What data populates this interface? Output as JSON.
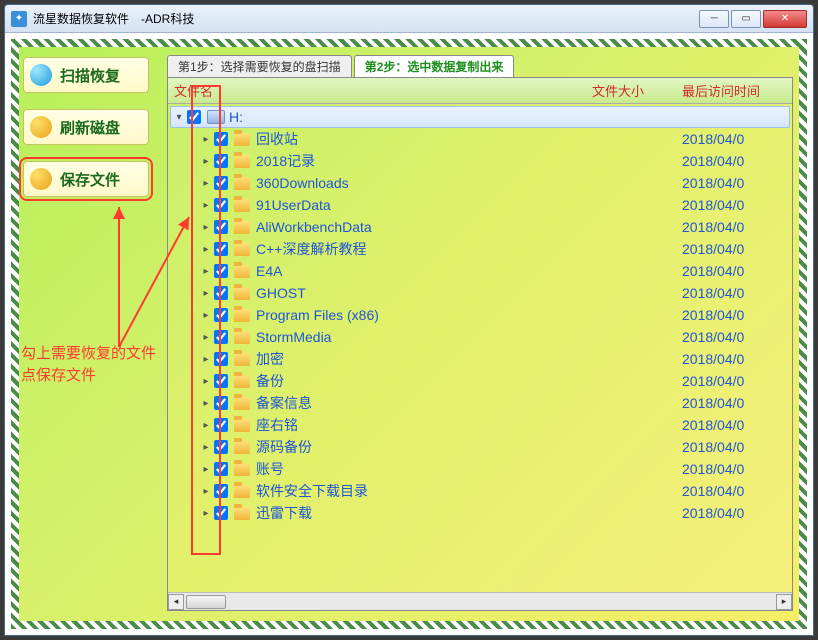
{
  "window": {
    "title": "流星数据恢复软件　-ADR科技"
  },
  "sidebar": {
    "scan_label": "扫描恢复",
    "refresh_label": "刷新磁盘",
    "save_label": "保存文件"
  },
  "tabs": {
    "step1": "第1步：选择需要恢复的盘扫描",
    "step2": "第2步：选中数据复制出来"
  },
  "columns": {
    "name": "文件名",
    "size": "文件大小",
    "time": "最后访问时间"
  },
  "root": {
    "label": "H:"
  },
  "files": [
    {
      "name": "回收站",
      "time": "2018/04/0"
    },
    {
      "name": "2018记录",
      "time": "2018/04/0"
    },
    {
      "name": "360Downloads",
      "time": "2018/04/0"
    },
    {
      "name": "91UserData",
      "time": "2018/04/0"
    },
    {
      "name": "AliWorkbenchData",
      "time": "2018/04/0"
    },
    {
      "name": "C++深度解析教程",
      "time": "2018/04/0"
    },
    {
      "name": "E4A",
      "time": "2018/04/0"
    },
    {
      "name": "GHOST",
      "time": "2018/04/0"
    },
    {
      "name": "Program Files (x86)",
      "time": "2018/04/0"
    },
    {
      "name": "StormMedia",
      "time": "2018/04/0"
    },
    {
      "name": "加密",
      "time": "2018/04/0"
    },
    {
      "name": "备份",
      "time": "2018/04/0"
    },
    {
      "name": "备案信息",
      "time": "2018/04/0"
    },
    {
      "name": "座右铭",
      "time": "2018/04/0"
    },
    {
      "name": "源码备份",
      "time": "2018/04/0"
    },
    {
      "name": "账号",
      "time": "2018/04/0"
    },
    {
      "name": "软件安全下载目录",
      "time": "2018/04/0"
    },
    {
      "name": "迅雷下载",
      "time": "2018/04/0"
    }
  ],
  "annotation": {
    "line1": "勾上需要恢复的文件",
    "line2": "点保存文件"
  }
}
